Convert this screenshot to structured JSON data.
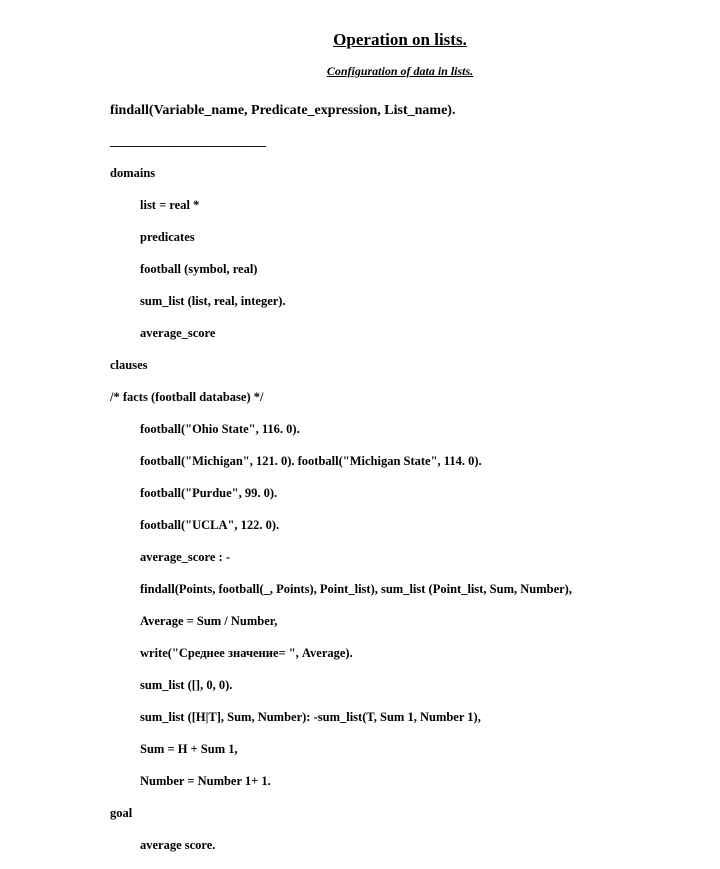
{
  "title": "Operation on lists.",
  "subtitle": "Configuration of data in lists.",
  "signature": "findall(Variable_name, Predicate_expression, List_name).",
  "divider": "________________________",
  "code": {
    "l1": "domains",
    "l2": "list = real *",
    "l3": "predicates",
    "l4": "football (symbol, real)",
    "l5": "sum_list (list, real, integer).",
    "l6": "average_score",
    "l7": "clauses",
    "l8": "/* facts (football database) */",
    "l9": "football(\"Ohio State\", 116. 0).",
    "l10": "football(\"Michigan\", 121. 0). football(\"Michigan State\", 114. 0).",
    "l11": "football(\"Purdue\", 99. 0).",
    "l12": "football(\"UCLA\", 122. 0).",
    "l13": "average_score : -",
    "l14": "findall(Points, football(_, Points), Point_list), sum_list (Point_list, Sum, Number),",
    "l15": "Average = Sum / Number,",
    "l16": "write(\"Среднее значение= \", Average).",
    "l17": "sum_list ([], 0, 0).",
    "l18": "sum_list ([H|T], Sum, Number): -sum_list(T, Sum 1, Number 1),",
    "l19": "Sum = H + Sum 1,",
    "l20": "Number = Number 1+ 1.",
    "l21": "goal",
    "l22": "average score."
  }
}
